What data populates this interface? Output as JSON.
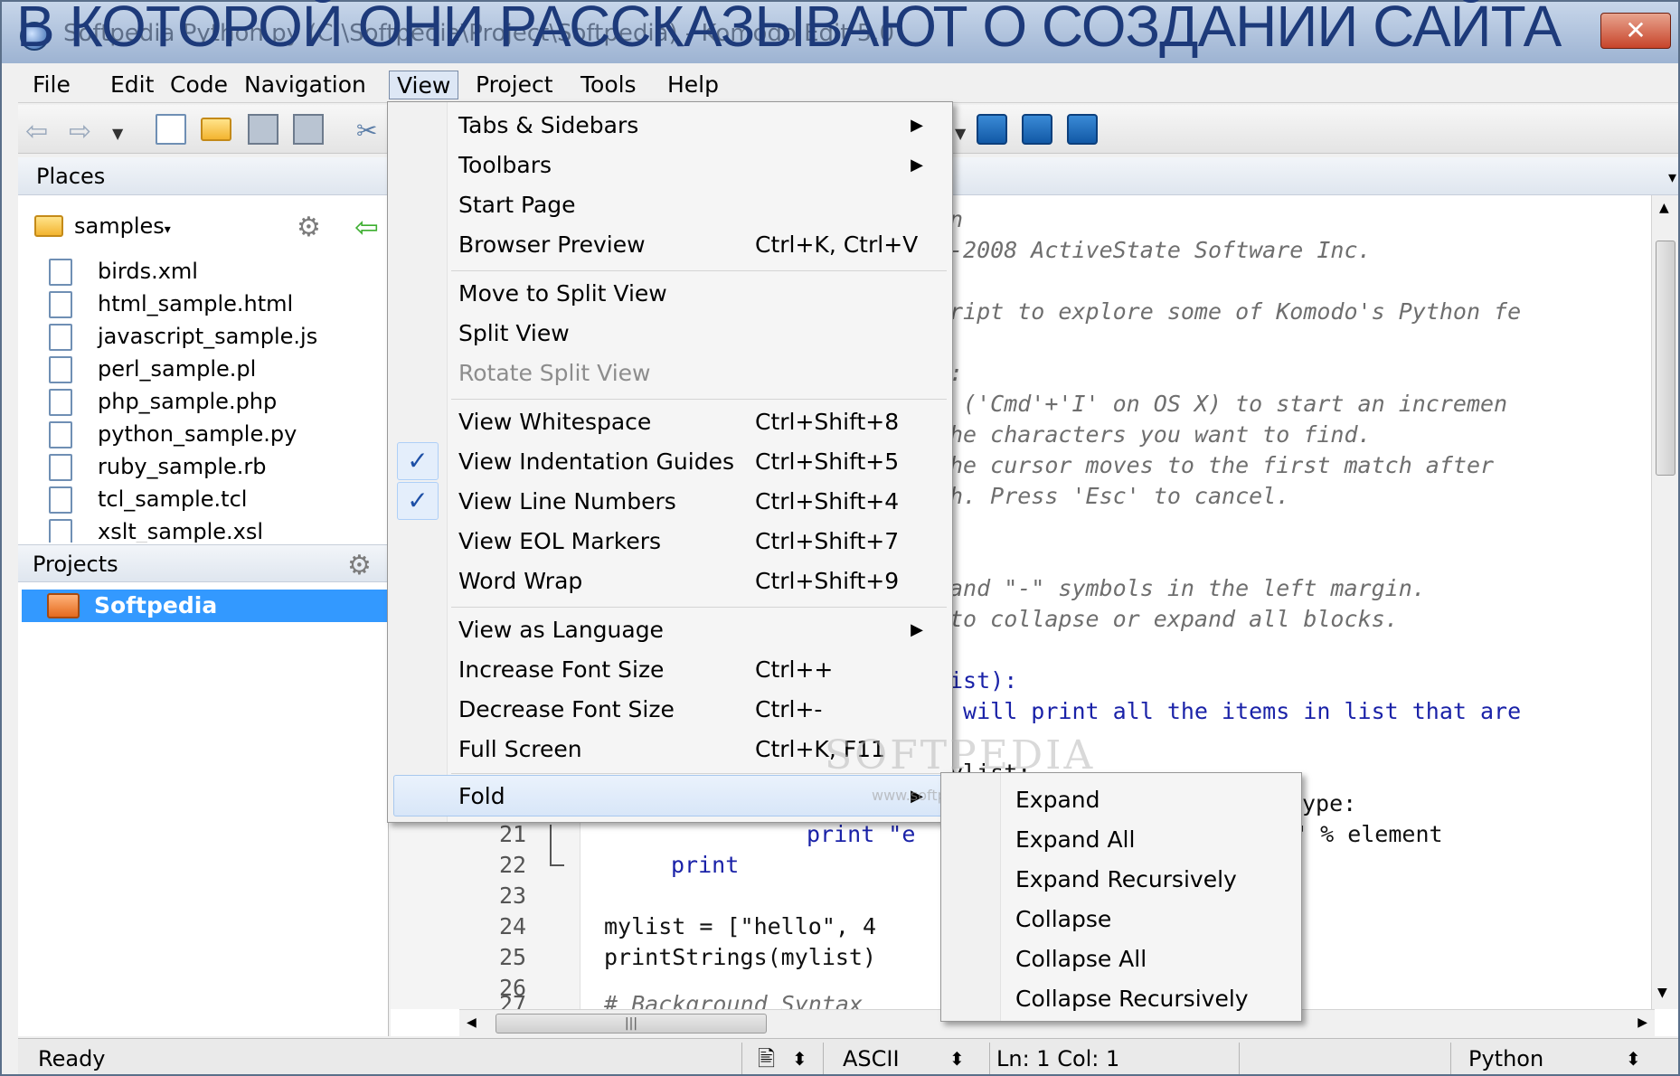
{
  "overlay_heading": "В КОТОРОЙ ОНИ РАССКАЗЫВАЮТ О СОЗДАНИИ САЙТА",
  "window": {
    "title": "Softpedia Python.py (C:\\Softpedia\\Project\\Softpedia) - Komodo Edit 5.0",
    "close_label": "✕"
  },
  "menubar": {
    "items": [
      "File",
      "Edit",
      "Code",
      "Navigation",
      "View",
      "Project",
      "Tools",
      "Help"
    ]
  },
  "places": {
    "header": "Places",
    "folder": "samples",
    "files": [
      "birds.xml",
      "html_sample.html",
      "javascript_sample.js",
      "perl_sample.pl",
      "php_sample.php",
      "python_sample.py",
      "ruby_sample.rb",
      "tcl_sample.tcl",
      "xslt_sample.xsl"
    ]
  },
  "projects": {
    "header": "Projects",
    "selected": "Softpedia"
  },
  "view_menu": {
    "items": [
      {
        "label": "Tabs & Sidebars",
        "shortcut": "",
        "submenu": true
      },
      {
        "label": "Toolbars",
        "shortcut": "",
        "submenu": true
      },
      {
        "label": "Start Page",
        "shortcut": ""
      },
      {
        "label": "Browser Preview",
        "shortcut": "Ctrl+K, Ctrl+V"
      },
      {
        "label": "Move to Split View",
        "shortcut": ""
      },
      {
        "label": "Split View",
        "shortcut": ""
      },
      {
        "label": "Rotate Split View",
        "shortcut": "",
        "disabled": true
      },
      {
        "label": "View Whitespace",
        "shortcut": "Ctrl+Shift+8"
      },
      {
        "label": "View Indentation Guides",
        "shortcut": "Ctrl+Shift+5",
        "checked": true
      },
      {
        "label": "View Line Numbers",
        "shortcut": "Ctrl+Shift+4",
        "checked": true
      },
      {
        "label": "View EOL Markers",
        "shortcut": "Ctrl+Shift+7"
      },
      {
        "label": "Word Wrap",
        "shortcut": "Ctrl+Shift+9"
      },
      {
        "label": "View as Language",
        "shortcut": "",
        "submenu": true
      },
      {
        "label": "Increase Font Size",
        "shortcut": "Ctrl++"
      },
      {
        "label": "Decrease Font Size",
        "shortcut": "Ctrl+-"
      },
      {
        "label": "Full Screen",
        "shortcut": "Ctrl+K, F11"
      },
      {
        "label": "Fold",
        "shortcut": "",
        "submenu": true,
        "highlighted": true
      }
    ],
    "submenu_arrow": "▶",
    "check_mark": "✓"
  },
  "fold_menu": {
    "items": [
      "Expand",
      "Expand All",
      "Expand Recursively",
      "Collapse",
      "Collapse All",
      "Collapse Recursively"
    ]
  },
  "editor": {
    "code_fragments": [
      "n",
      "-2008 ActiveState Software Inc.",
      "ript to explore some of Komodo's Python fe",
      ":",
      " ('Cmd'+'I' on OS X) to start an incremen",
      "he characters you want to find.",
      "he cursor moves to the first match after",
      "h. Press 'Esc' to cancel.",
      "and \"-\" symbols in the left margin.",
      "to collapse or expand all blocks.",
      "ist):",
      " will print all the items in list that are",
      "ylist:",
      "ype:",
      "\" % element",
      "print \"e",
      "print",
      "mylist = [\"hello\", 4",
      "printStrings(mylist)",
      "# Background Syntax"
    ],
    "line_numbers": [
      "21",
      "22",
      "23",
      "24",
      "25",
      "26",
      "27"
    ]
  },
  "statusbar": {
    "ready": "Ready",
    "encoding": "ASCII",
    "position": "Ln: 1 Col: 1",
    "language": "Python",
    "spinner": "⬍"
  },
  "watermark": {
    "brand": "SOFTPEDIA",
    "url": "www.softpedia.com"
  }
}
